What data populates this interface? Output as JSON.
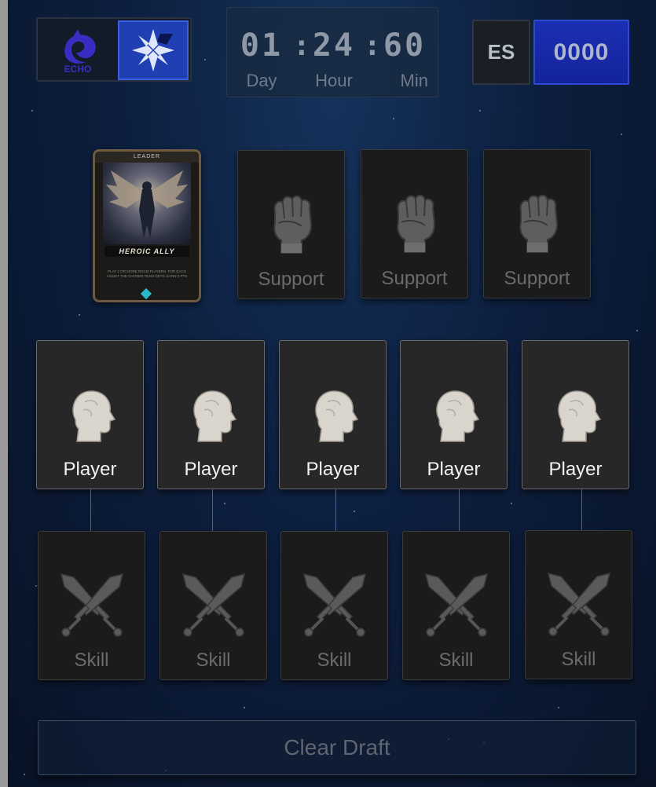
{
  "header": {
    "brand_logo_text": "ECHO",
    "timer": {
      "day": "01",
      "hour": "24",
      "min": "60",
      "separator": ":",
      "day_label": "Day",
      "hour_label": "Hour",
      "min_label": "Min"
    },
    "language_label": "ES",
    "points_value": "0000"
  },
  "leader_card": {
    "top_label": "LEADER",
    "name": "HEROIC ALLY",
    "description": "PLAY 2 OR MORE ROAM PLAYERS. FOR EACH ASSIST THE CHOSEN TEAM GETS, EARN 2 PTS"
  },
  "support_slots": [
    {
      "label": "Support"
    },
    {
      "label": "Support"
    },
    {
      "label": "Support"
    }
  ],
  "player_slots": [
    {
      "label": "Player"
    },
    {
      "label": "Player"
    },
    {
      "label": "Player"
    },
    {
      "label": "Player"
    },
    {
      "label": "Player"
    }
  ],
  "skill_slots": [
    {
      "label": "Skill"
    },
    {
      "label": "Skill"
    },
    {
      "label": "Skill"
    },
    {
      "label": "Skill"
    },
    {
      "label": "Skill"
    }
  ],
  "clear_button_label": "Clear Draft",
  "colors": {
    "background": "#0b1a33",
    "accent_blue": "#1f3fb3",
    "slot_dark": "#1b1b1b",
    "player_slot": "#272727"
  },
  "icons": {
    "brand": "echo-orca-logo",
    "team": "team-star-logo",
    "support": "fist-icon",
    "player": "head-icon",
    "skill": "crossed-swords-icon"
  }
}
